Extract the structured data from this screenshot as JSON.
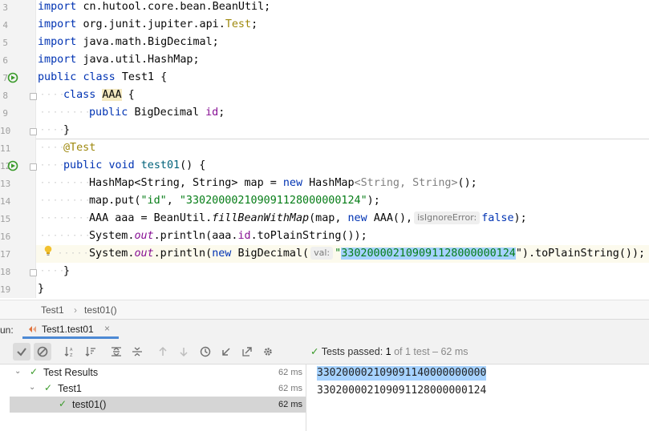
{
  "editor": {
    "line_numbers": [
      "3",
      "4",
      "5",
      "6",
      "7",
      "8",
      "9",
      "10",
      "11",
      "12",
      "13",
      "14",
      "15",
      "16",
      "17",
      "18",
      "19"
    ],
    "imports": [
      {
        "kw": "import",
        "path": "cn.hutool.core.bean.BeanUtil;",
        "test": ""
      },
      {
        "kw": "import",
        "path": "org.junit.jupiter.api.",
        "test": "Test"
      },
      {
        "kw": "import",
        "path": "java.math.BigDecimal;",
        "test": ""
      },
      {
        "kw": "import",
        "path": "java.util.HashMap;",
        "test": ""
      }
    ],
    "semicolon": ";",
    "kw_public": "public",
    "kw_class": "class",
    "kw_void": "void",
    "kw_new": "new",
    "class_name": "Test1",
    "brace_open": " {",
    "brace_close": "}",
    "inner_class": "AAA",
    "field_type": "BigDecimal",
    "field_name": "id",
    "annotation": "@Test",
    "method_name": "test01",
    "method_sig": "() {",
    "line_map": "HashMap<String, String> map = ",
    "line_map_new_type": "HashMap",
    "line_map_generic": "<String, String>",
    "line_map_end": "();",
    "line_put_start": "map.put(",
    "line_put_key": "\"id\"",
    "line_put_comma": ", ",
    "line_put_val": "\"330200002109091128000000124\"",
    "line_put_end": ");",
    "line_aaa_start": "AAA aaa = BeanUtil.",
    "line_aaa_method": "fillBeanWithMap",
    "line_aaa_args": "(map, ",
    "line_aaa_new": "AAA(),",
    "hint_ignore": "isIgnoreError:",
    "kw_false": "false",
    "line_aaa_end": ");",
    "sysout_start": "System.",
    "sysout_out": "out",
    "sysout_print": ".println(",
    "line_print1_arg": "aaa.",
    "line_print1_field": "id",
    "line_print1_end": ".toPlainString());",
    "line_print2_new": "BigDecimal(",
    "hint_val": "val:",
    "quote": "\"",
    "line_print2_selected": "330200002109091128000000124",
    "line_print2_end": "\").toPlainString());"
  },
  "breadcrumb": {
    "items": [
      "Test1",
      "test01()"
    ],
    "separator": "›"
  },
  "run_panel": {
    "label": "un:",
    "tab_name": "Test1.test01",
    "tab_close": "×",
    "status_prefix": "Tests passed:",
    "status_count": "1",
    "status_suffix": "of 1 test – 62 ms"
  },
  "test_tree": [
    {
      "label": "Test Results",
      "time": "62 ms"
    },
    {
      "label": "Test1",
      "time": "62 ms"
    },
    {
      "label": "test01()",
      "time": "62 ms"
    }
  ],
  "console": {
    "lines": [
      "330200002109091140000000000",
      "330200002109091128000000124"
    ]
  },
  "icons": {
    "check": "✓",
    "arrow_down": "⌄",
    "colors": {
      "pass": "#3a9a2a",
      "selection": "#a6d2ff",
      "keyword": "#0033b3",
      "string": "#067d17"
    }
  }
}
